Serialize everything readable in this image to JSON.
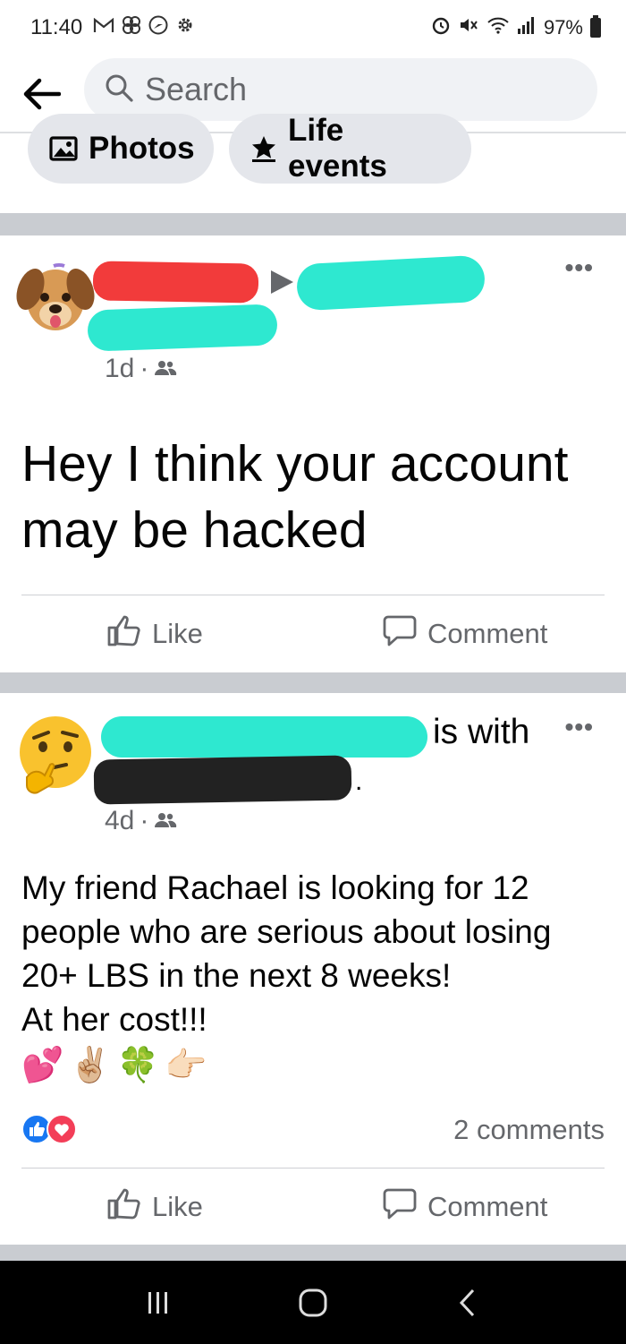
{
  "status_bar": {
    "time": "11:40",
    "left_icons": [
      "gmail-icon",
      "pinwheel-icon",
      "navigation-icon",
      "settings-icon"
    ],
    "battery": "97%",
    "right_icons": [
      "alarm-icon",
      "mute-icon",
      "wifi-icon",
      "signal-icon",
      "battery-icon"
    ]
  },
  "search": {
    "placeholder": "Search"
  },
  "chips": [
    {
      "label": "Photos",
      "icon": "photo-icon"
    },
    {
      "label": "Life events",
      "icon": "star-icon"
    }
  ],
  "posts": [
    {
      "avatar": "puppy-emoji",
      "time": "1d",
      "separator": "·",
      "audience_icon": "friends-icon",
      "text_lines": [
        "Hey I think your account",
        "may be hacked"
      ],
      "actions": {
        "like": "Like",
        "comment": "Comment"
      }
    },
    {
      "avatar": "thinking-face-emoji",
      "is_with": "is with",
      "period": ".",
      "time": "4d",
      "separator": "·",
      "audience_icon": "friends-icon",
      "text_lines": [
        "My friend Rachael is looking for 12",
        "people who are serious about losing",
        "20+ LBS in the next 8 weeks!",
        "At her cost!!!"
      ],
      "emojis": "💕✌🏼🍀👉🏻",
      "reactions": [
        "like-reaction",
        "love-reaction"
      ],
      "comments_count": "2 comments",
      "actions": {
        "like": "Like",
        "comment": "Comment"
      }
    }
  ],
  "colors": {
    "fb_blue": "#1877f2",
    "love_red": "#f33e58",
    "redact_red": "#f23b3b",
    "redact_teal": "#2ee8d0",
    "redact_black": "#222222",
    "separator": "#c9ccd1"
  }
}
